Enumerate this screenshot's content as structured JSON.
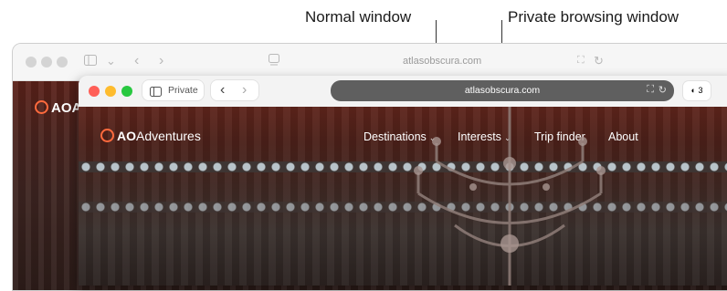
{
  "callouts": {
    "normal_window": "Normal window",
    "private_window": "Private browsing window"
  },
  "normal_window": {
    "address": "atlasobscura.com",
    "site_logo": "AOA"
  },
  "private_window": {
    "private_label": "Private",
    "address": "atlasobscura.com",
    "tab_count": "3",
    "site": {
      "logo_bold": "AO",
      "logo_rest": "Adventures",
      "nav": [
        {
          "label": "Destinations",
          "has_menu": true
        },
        {
          "label": "Interests",
          "has_menu": true
        },
        {
          "label": "Trip finder",
          "has_menu": false
        },
        {
          "label": "About",
          "has_menu": false
        }
      ]
    }
  },
  "colors": {
    "close": "#ff5f57",
    "minimize": "#febc2e",
    "zoom": "#28c840",
    "private_address_bar": "#5f5f5f",
    "logo_accent": "#ff6a3d"
  },
  "icons": [
    "sidebar-icon",
    "chevron-down-icon",
    "back-arrow-icon",
    "forward-arrow-icon",
    "reader-icon",
    "translate-icon",
    "reload-icon",
    "tab-overview-icon",
    "chevron-down-icon"
  ]
}
